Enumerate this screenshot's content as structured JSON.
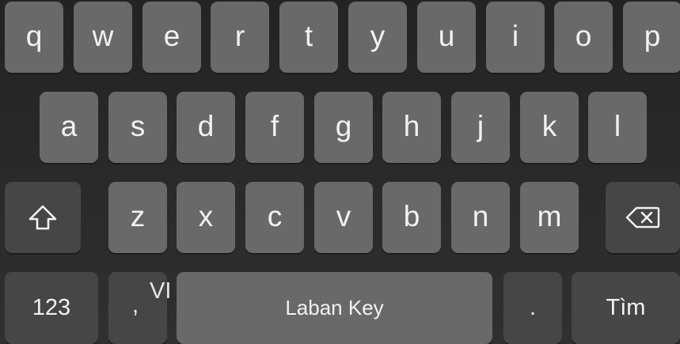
{
  "keyboard": {
    "row1": [
      "q",
      "w",
      "e",
      "r",
      "t",
      "y",
      "u",
      "i",
      "o",
      "p"
    ],
    "row2": [
      "a",
      "s",
      "d",
      "f",
      "g",
      "h",
      "j",
      "k",
      "l"
    ],
    "row3": [
      "z",
      "x",
      "c",
      "v",
      "b",
      "n",
      "m"
    ],
    "numbers_label": "123",
    "language_label": "VI",
    "comma_label": ",",
    "space_label": "Laban Key",
    "period_label": ".",
    "search_label": "Tìm",
    "shift_icon": "shift-arrow-icon",
    "backspace_icon": "backspace-icon"
  }
}
